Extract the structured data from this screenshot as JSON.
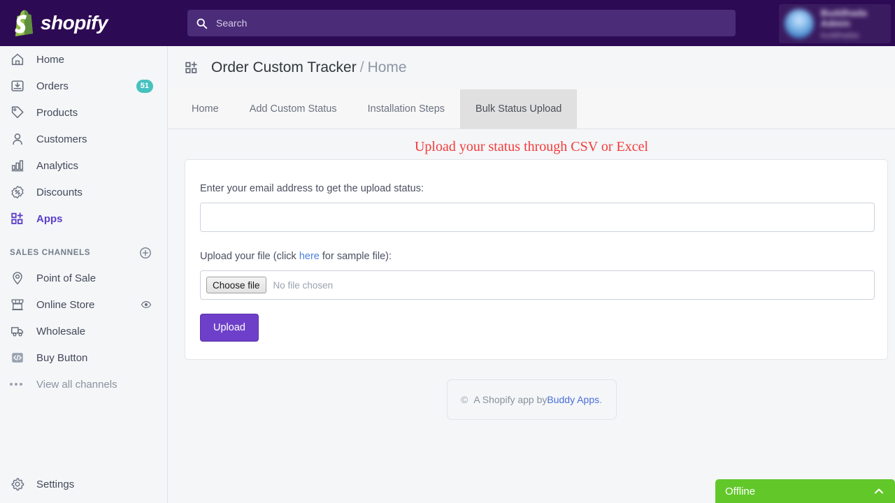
{
  "topbar": {
    "brand": "shopify",
    "search": {
      "placeholder": "Search",
      "icon": "search-icon"
    },
    "user": {
      "name": "Buddhada Admin",
      "store": "buddhadas"
    }
  },
  "sidebar": {
    "items": [
      {
        "label": "Home",
        "icon": "home-icon",
        "badge": null,
        "active": false
      },
      {
        "label": "Orders",
        "icon": "orders-icon",
        "badge": "51",
        "active": false
      },
      {
        "label": "Products",
        "icon": "products-tag-icon",
        "badge": null,
        "active": false
      },
      {
        "label": "Customers",
        "icon": "customers-person-icon",
        "badge": null,
        "active": false
      },
      {
        "label": "Analytics",
        "icon": "analytics-bars-icon",
        "badge": null,
        "active": false
      },
      {
        "label": "Discounts",
        "icon": "discounts-percent-icon",
        "badge": null,
        "active": false
      },
      {
        "label": "Apps",
        "icon": "apps-grid-plus-icon",
        "badge": null,
        "active": true
      }
    ],
    "section": {
      "title": "SALES CHANNELS",
      "add_icon": "plus-circle-icon"
    },
    "channels": [
      {
        "label": "Point of Sale",
        "icon": "location-pin-icon",
        "trailing": null
      },
      {
        "label": "Online Store",
        "icon": "storefront-icon",
        "trailing": "eye-icon"
      },
      {
        "label": "Wholesale",
        "icon": "delivery-truck-icon",
        "trailing": null
      },
      {
        "label": "Buy Button",
        "icon": "code-brackets-icon",
        "trailing": null
      },
      {
        "label": "View all channels",
        "icon": "ellipsis-icon",
        "trailing": null
      }
    ],
    "settings": {
      "label": "Settings",
      "icon": "gear-icon"
    }
  },
  "page": {
    "icon": "apps-grid-plus-icon",
    "title": "Order Custom Tracker",
    "separator": "/",
    "breadcrumb": "Home"
  },
  "tabs": [
    {
      "label": "Home",
      "active": false
    },
    {
      "label": "Add Custom Status",
      "active": false
    },
    {
      "label": "Installation Steps",
      "active": false
    },
    {
      "label": "Bulk Status Upload",
      "active": true
    }
  ],
  "form": {
    "heading": "Upload your status through CSV or Excel",
    "email_label": "Enter your email address to get the upload status:",
    "email_value": "",
    "email_placeholder": "",
    "upload_label_pre": "Upload your file (click ",
    "upload_link": "here",
    "upload_label_post": " for sample file):",
    "choose_file_button": "Choose file",
    "no_file_text": "No file chosen",
    "submit_label": "Upload"
  },
  "footer": {
    "copyright_symbol": "©",
    "text": "A Shopify app by ",
    "link": "Buddy Apps",
    "period": "."
  },
  "chat": {
    "label": "Offline",
    "chevron": "chevron-up-icon"
  },
  "colors": {
    "topbar_bg": "#2d0a54",
    "search_bg": "#4a2c78",
    "accent_purple": "#5c3ecb",
    "upload_button": "#6e40c9",
    "badge_teal": "#47c1bf",
    "heading_red": "#f63a3a",
    "link_blue": "#4a7fe0",
    "chat_green": "#62c82a",
    "sidebar_bg": "#f4f6f8",
    "active_tab_bg": "#e0e0e0"
  }
}
